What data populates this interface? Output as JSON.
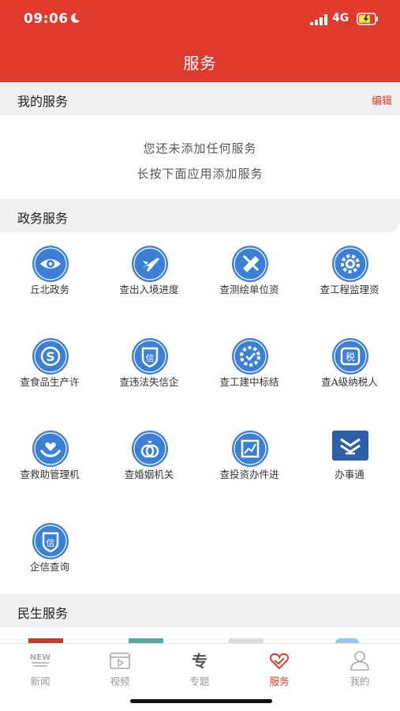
{
  "status": {
    "time": "09:06",
    "network": "4G"
  },
  "header": {
    "title": "服务"
  },
  "my_services": {
    "label": "我的服务",
    "edit": "编辑",
    "empty_line1": "您还未添加任何服务",
    "empty_line2": "长按下面应用添加服务"
  },
  "gov": {
    "label": "政务服务",
    "items": [
      {
        "name": "丘北政务",
        "icon": "eye-icon"
      },
      {
        "name": "查出入境进度",
        "icon": "airplane-icon"
      },
      {
        "name": "查测绘单位资",
        "icon": "ruler-pencil-icon"
      },
      {
        "name": "查工程监理资",
        "icon": "gear-icon"
      },
      {
        "name": "查食品生产许",
        "icon": "s-badge-icon"
      },
      {
        "name": "查违法失信企",
        "icon": "credit-shield-icon"
      },
      {
        "name": "查工建中标结",
        "icon": "cog-check-icon"
      },
      {
        "name": "查A级纳税人",
        "icon": "tax-icon"
      },
      {
        "name": "查救助管理机",
        "icon": "heart-hand-icon"
      },
      {
        "name": "查婚姻机关",
        "icon": "rings-icon"
      },
      {
        "name": "查投资办件进",
        "icon": "chart-icon"
      },
      {
        "name": "办事通",
        "icon": "banshitong-logo"
      },
      {
        "name": "企信查询",
        "icon": "credit-shield-icon"
      }
    ]
  },
  "livelihood": {
    "label": "民生服务"
  },
  "tabbar": {
    "items": [
      {
        "label": "新闻",
        "icon": "news-icon"
      },
      {
        "label": "视频",
        "icon": "video-icon"
      },
      {
        "label": "专题",
        "icon": "topic-icon"
      },
      {
        "label": "服务",
        "icon": "service-heart-icon",
        "active": true
      },
      {
        "label": "我的",
        "icon": "person-icon"
      }
    ]
  },
  "colors": {
    "brand_red": "#e03a2f",
    "icon_blue": "#3b7fd6"
  }
}
